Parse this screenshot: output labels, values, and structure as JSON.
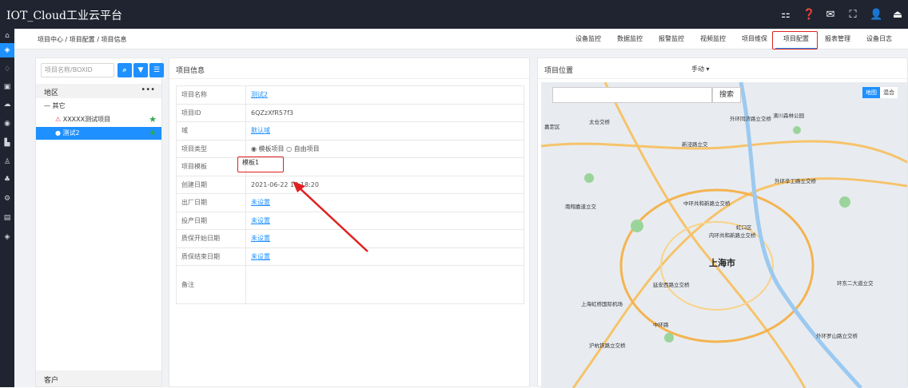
{
  "app": {
    "title": "IOT_Cloud工业云平台"
  },
  "topbar_icons": [
    "app-grid-icon",
    "help-icon",
    "mail-icon",
    "fullscreen-icon",
    "user-icon",
    "logout-icon"
  ],
  "breadcrumb": "项目中心 / 项目配置 / 项目信息",
  "nav_tabs": [
    {
      "label": "设备监控"
    },
    {
      "label": "数据监控"
    },
    {
      "label": "报警监控"
    },
    {
      "label": "视频监控"
    },
    {
      "label": "项目维保"
    },
    {
      "label": "项目配置",
      "active": true
    },
    {
      "label": "报表管理"
    },
    {
      "label": "设备日志"
    }
  ],
  "left_panel": {
    "search_placeholder": "项目名称/BOXID",
    "region_header": "地区",
    "more": "•••",
    "tree_group": "— 其它",
    "items": [
      {
        "label": "XXXXX测试项目",
        "status": "offline"
      },
      {
        "label": "测试2",
        "status": "selected"
      }
    ],
    "customer_header": "客户"
  },
  "project_info": {
    "title": "项目信息",
    "rows": [
      {
        "key": "项目名称",
        "value": "测试2",
        "link": true
      },
      {
        "key": "项目ID",
        "value": "6QZzXfR57f3",
        "link": false
      },
      {
        "key": "域",
        "value": "默认域",
        "link": true
      },
      {
        "key": "项目类型",
        "value": "",
        "link": false
      },
      {
        "key": "项目模板",
        "value": "模板1",
        "link": false
      },
      {
        "key": "创建日期",
        "value": "2021-06-22 18:18:20",
        "link": false
      },
      {
        "key": "出厂日期",
        "value": "未设置",
        "link": true
      },
      {
        "key": "投产日期",
        "value": "未设置",
        "link": true
      },
      {
        "key": "质保开始日期",
        "value": "未设置",
        "link": true
      },
      {
        "key": "质保结束日期",
        "value": "未设置",
        "link": true
      },
      {
        "key": "备注",
        "value": "",
        "link": false
      }
    ],
    "type_options": {
      "option1": "模板项目",
      "option2": "自由项目"
    }
  },
  "location": {
    "title": "项目位置",
    "mode": "手动",
    "map_search_button": "搜索",
    "map_types": [
      "地图",
      "混合"
    ],
    "labels": [
      "嘉定区",
      "太仓交桥",
      "外环同济路立交桥",
      "滴川森林公园",
      "新泾路立交",
      "上海市",
      "外环辛工路立交桥",
      "中环路",
      "延安西路立交桥",
      "外环罗山路立交桥",
      "虹口区",
      "内环共和新路立交桥",
      "沪杭铁路立交桥",
      "南翔嘉道立交",
      "中环共和新路立交桥",
      "上海虹桥国际机场",
      "环东二大道立交"
    ]
  }
}
